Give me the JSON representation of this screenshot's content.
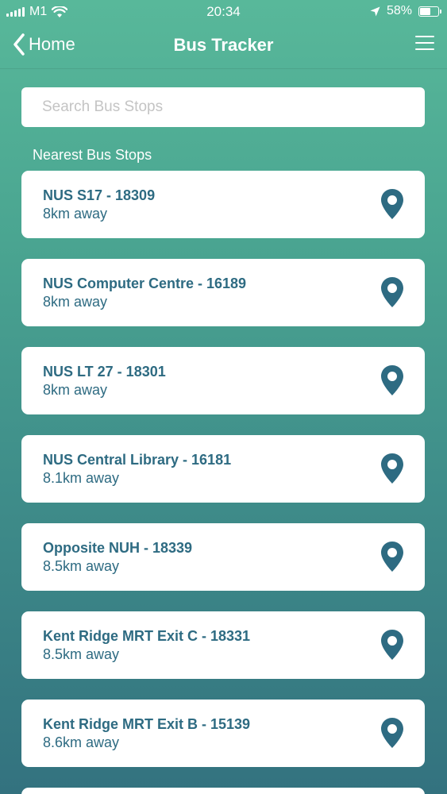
{
  "status_bar": {
    "carrier": "M1",
    "time": "20:34",
    "battery": "58%",
    "battery_level": 0.58
  },
  "nav": {
    "back_label": "Home",
    "title": "Bus Tracker"
  },
  "search": {
    "placeholder": "Search Bus Stops",
    "value": ""
  },
  "section_label": "Nearest Bus Stops",
  "stops": [
    {
      "name": "NUS S17 - 18309",
      "distance": "8km away"
    },
    {
      "name": "NUS Computer Centre - 16189",
      "distance": "8km away"
    },
    {
      "name": "NUS LT 27 - 18301",
      "distance": "8km away"
    },
    {
      "name": "NUS Central Library - 16181",
      "distance": "8.1km away"
    },
    {
      "name": "Opposite NUH - 18339",
      "distance": "8.5km away"
    },
    {
      "name": "Kent Ridge MRT Exit C - 18331",
      "distance": "8.5km away"
    },
    {
      "name": "Kent Ridge MRT Exit B - 15139",
      "distance": "8.6km away"
    }
  ],
  "colors": {
    "accent": "#2e6b82",
    "gradient_top": "#58b89a",
    "gradient_bottom": "#33727f"
  },
  "icons": {
    "back": "chevron-left-icon",
    "menu": "hamburger-menu-icon",
    "stop": "map-pin-icon"
  }
}
